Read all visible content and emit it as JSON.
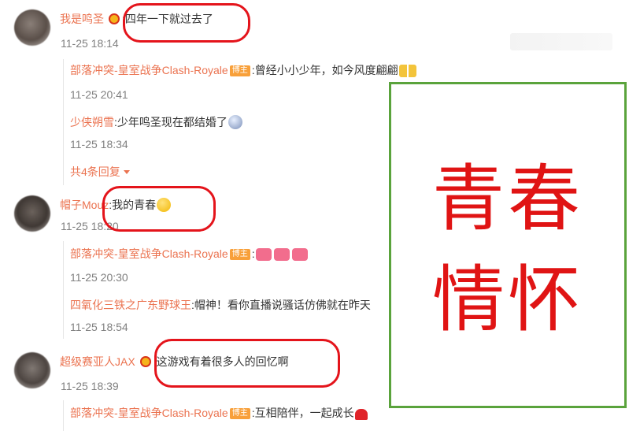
{
  "comments": [
    {
      "username": "我是鸣圣",
      "text": ":四年一下就过去了",
      "time": "11-25 18:14",
      "replies": [
        {
          "username": "部落冲突-皇室战争Clash-Royale",
          "badge": "博主",
          "text": ":曾经小小少年，如今风度翩翩",
          "time": "11-25 20:41"
        },
        {
          "username": "少侠朔雪",
          "text": ":少年鸣圣现在都结婚了",
          "time": "11-25 18:34"
        }
      ],
      "more_replies": "共4条回复"
    },
    {
      "username": "帽子Mouz",
      "text": ":我的青春",
      "time": "11-25 18:20",
      "replies": [
        {
          "username": "部落冲突-皇室战争Clash-Royale",
          "badge": "博主",
          "text": ":",
          "time": "11-25 20:30"
        },
        {
          "username": "四氧化三铁之广东野球王",
          "text": ":帽神！看你直播说骚话仿佛就在昨天",
          "time": "11-25 18:54"
        }
      ]
    },
    {
      "username": "超级赛亚人JAX",
      "text": ":这游戏有着很多人的回忆啊",
      "time": "11-25 18:39",
      "replies": [
        {
          "username": "部落冲突-皇室战争Clash-Royale",
          "badge": "博主",
          "text": ":互相陪伴，一起成长"
        }
      ]
    }
  ],
  "overlay": {
    "line1": "青春",
    "line2": "情怀"
  },
  "colors": {
    "username": "#eb7350",
    "highlight_ring": "#e4141b",
    "overlay_text": "#e01414",
    "overlay_border": "#5aa33c"
  },
  "icons": [
    "crown-badge-icon",
    "cheers-emoji",
    "shocked-face-emoji",
    "thinking-emoji",
    "heart-emoji",
    "red-heart-emoji"
  ]
}
